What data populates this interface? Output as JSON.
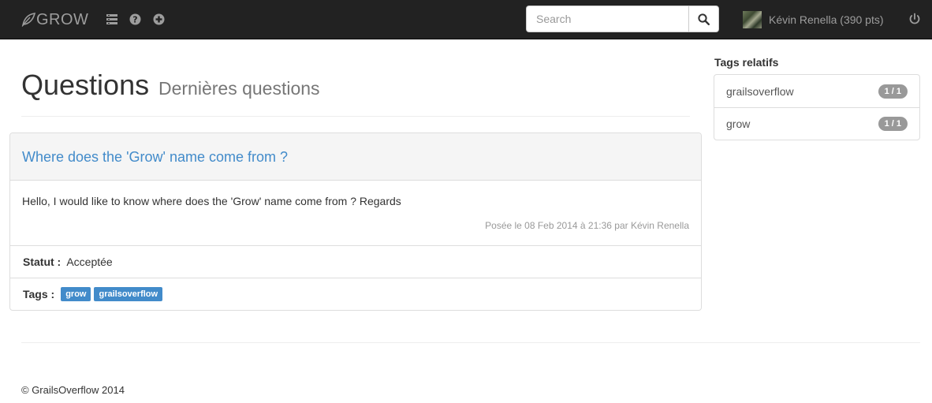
{
  "navbar": {
    "brand": "GROW",
    "search_placeholder": "Search",
    "user_label": "Kévin Renella (390 pts)",
    "icons": [
      "list-icon",
      "help-icon",
      "add-icon",
      "search-icon",
      "power-icon"
    ]
  },
  "header": {
    "title": "Questions",
    "subtitle": "Dernières questions"
  },
  "question": {
    "title": "Where does the 'Grow' name come from ?",
    "body": "Hello,  I would like to know where does the 'Grow' name come from ? Regards",
    "meta": "Posée le 08 Feb 2014 à 21:36 par Kévin Renella",
    "status_label": "Statut :",
    "status_value": "Acceptée",
    "tags_label": "Tags :",
    "tags": [
      "grow",
      "grailsoverflow"
    ]
  },
  "sidebar": {
    "title": "Tags relatifs",
    "items": [
      {
        "label": "grailsoverflow",
        "badge": "1 / 1"
      },
      {
        "label": "grow",
        "badge": "1 / 1"
      }
    ]
  },
  "footer": {
    "text": "© GrailsOverflow 2014"
  },
  "colors": {
    "navbar_bg": "#222222",
    "link": "#428bca",
    "badge": "#999999"
  }
}
